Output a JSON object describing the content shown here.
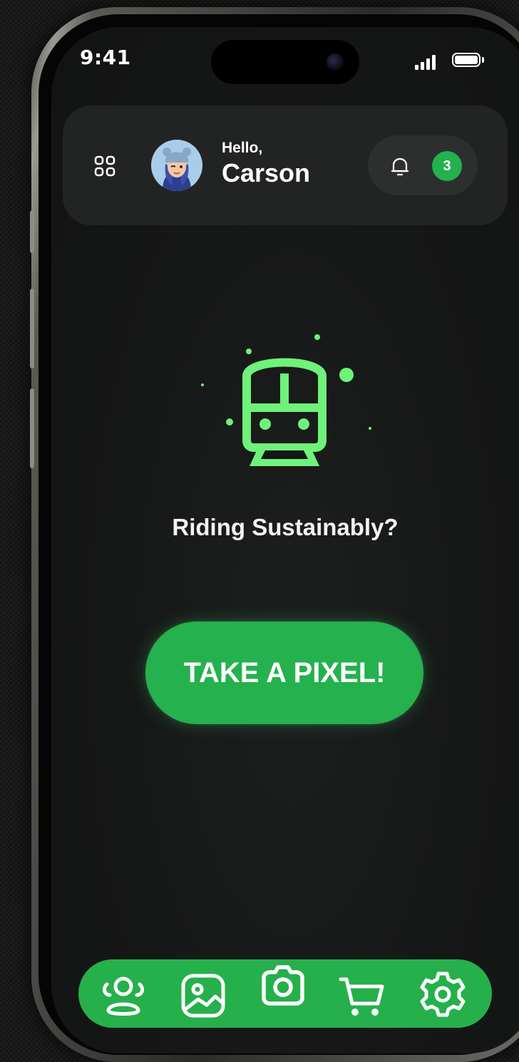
{
  "status_bar": {
    "time": "9:41"
  },
  "header": {
    "greeting": "Hello,",
    "user_name": "Carson",
    "notification_count": "3"
  },
  "main": {
    "illustration_icon": "train-icon",
    "headline": "Riding Sustainably?",
    "cta_label": "TAKE A PIXEL!"
  },
  "tab_bar": {
    "items": [
      {
        "icon": "community-icon"
      },
      {
        "icon": "gallery-icon"
      },
      {
        "icon": "camera-icon"
      },
      {
        "icon": "cart-icon"
      },
      {
        "icon": "settings-icon"
      }
    ]
  },
  "colors": {
    "accent": "#24b14e",
    "illustration": "#6ef27a",
    "background": "#161717",
    "card": "#222424"
  }
}
